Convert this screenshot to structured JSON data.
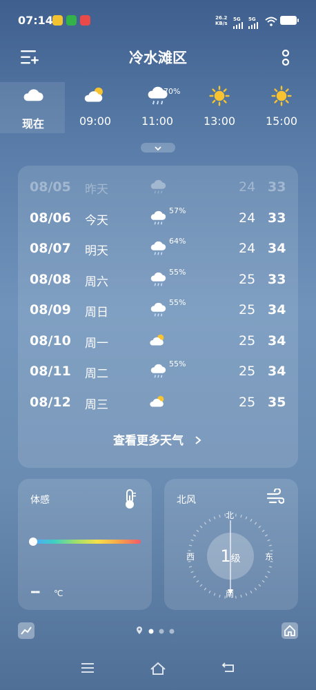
{
  "status_bar": {
    "time": "07:14",
    "net_speed": "26.2",
    "net_unit": "KB/s",
    "sig1": "5G",
    "sig2": "5G",
    "app_colors": [
      "#f2c230",
      "#34b24a",
      "#e84a4a"
    ]
  },
  "header": {
    "title": "冷水滩区",
    "menu_icon": "add-city-icon",
    "more_icon": "more-vertical-icon"
  },
  "hourly": [
    {
      "time": "现在",
      "icon": "cloudy",
      "pop": "",
      "selected": true
    },
    {
      "time": "09:00",
      "icon": "partly-cloudy",
      "pop": ""
    },
    {
      "time": "11:00",
      "icon": "rain",
      "pop": "70%"
    },
    {
      "time": "13:00",
      "icon": "sunny",
      "pop": ""
    },
    {
      "time": "15:00",
      "icon": "sunny",
      "pop": ""
    }
  ],
  "daily": [
    {
      "date": "08/05",
      "day": "昨天",
      "icon": "rain",
      "pop": "",
      "low": "24",
      "high": "33",
      "past": true
    },
    {
      "date": "08/06",
      "day": "今天",
      "icon": "rain",
      "pop": "57%",
      "low": "24",
      "high": "33"
    },
    {
      "date": "08/07",
      "day": "明天",
      "icon": "rain",
      "pop": "64%",
      "low": "24",
      "high": "34"
    },
    {
      "date": "08/08",
      "day": "周六",
      "icon": "rain",
      "pop": "55%",
      "low": "25",
      "high": "33"
    },
    {
      "date": "08/09",
      "day": "周日",
      "icon": "rain",
      "pop": "55%",
      "low": "25",
      "high": "34"
    },
    {
      "date": "08/10",
      "day": "周一",
      "icon": "partly-cloudy",
      "pop": "",
      "low": "25",
      "high": "34"
    },
    {
      "date": "08/11",
      "day": "周二",
      "icon": "rain",
      "pop": "55%",
      "low": "25",
      "high": "34"
    },
    {
      "date": "08/12",
      "day": "周三",
      "icon": "partly-cloudy",
      "pop": "",
      "low": "25",
      "high": "35"
    }
  ],
  "more_weather": "查看更多天气",
  "feels": {
    "label": "体感",
    "value": "--",
    "unit": "℃",
    "icon": "thermometer-icon",
    "level": 0
  },
  "wind": {
    "label": "北风",
    "level": "1",
    "level_unit": "级",
    "n": "北",
    "s": "南",
    "w": "西",
    "e": "东",
    "icon": "wind-icon"
  },
  "bottom": {
    "left_icon": "trend-chart-icon",
    "right_icon": "home-icon",
    "page_count": 3,
    "active_page": 0
  },
  "nav": {
    "menu": "menu-icon",
    "home": "home-nav-icon",
    "back": "back-icon"
  }
}
